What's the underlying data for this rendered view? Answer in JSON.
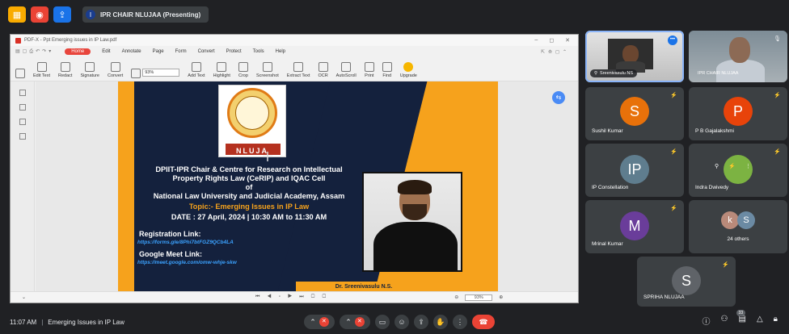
{
  "meeting": {
    "presenter_label": "IPR CHAIR NLUJAA (Presenting)",
    "presenter_initial": "I",
    "time": "11:07 AM",
    "separator": "|",
    "meeting_title": "Emerging Issues in IP Law",
    "participants_count": "33"
  },
  "pdf": {
    "window_title": "PDF-X - Ppt Emerging issues in IP Law.pdf",
    "menu": [
      "Home",
      "Edit",
      "Annotate",
      "Page",
      "Form",
      "Convert",
      "Protect",
      "Tools",
      "Help"
    ],
    "tools": [
      "Edit Text",
      "Redact",
      "Signature",
      "Convert",
      "Add Text",
      "Highlight",
      "Crop",
      "Screenshot",
      "Extract Text",
      "OCR",
      "AutoScroll",
      "Print",
      "Find",
      "Upgrade"
    ],
    "zoom": "93%",
    "status_zoom": "93%"
  },
  "poster": {
    "logo_text": "NLUJA",
    "line1": "DPIIT-IPR Chair & Centre for Research on Intellectual",
    "line2": "Property Rights Law (CeRIP) and IQAC Cell",
    "line3": "of",
    "line4": "National Law University and Judicial Academy, Assam",
    "topic": "Topic:- Emerging Issues in IP Law",
    "date": "DATE : 27 April, 2024  |  10:30 AM to 11:30 AM",
    "reg_label": "Registration Link:",
    "reg_link": "https://forms.gle/8Phi7btFGZ9QCb4LA",
    "meet_label": "Google Meet Link:",
    "meet_link": "https://meet.google.com/omw-whje-skw",
    "speaker": "Dr. Sreenivasulu N.S."
  },
  "tiles": [
    {
      "name": "Sreenivasulu NS",
      "kind": "video"
    },
    {
      "name": "IPR CHAIR NLUJAA",
      "kind": "video"
    },
    {
      "name": "Sushil Kumar",
      "initial": "S",
      "color": "#e8710a"
    },
    {
      "name": "P B Gajalakshmi",
      "initial": "P",
      "color": "#e8430a"
    },
    {
      "name": "IP Constellation",
      "initial": "IP",
      "color": "#5f7d8e"
    },
    {
      "name": "Indra Dwivedy",
      "kind": "speaking"
    },
    {
      "name": "Mrinal Kumar",
      "initial": "M",
      "color": "#6a3d9a"
    },
    {
      "name": "24 others",
      "initials": [
        "k",
        "S"
      ]
    },
    {
      "name": "SPRIHA NLUJAA",
      "initial": "S",
      "color": "#5f6368"
    }
  ],
  "colors": {
    "accent_red": "#ea4335",
    "navy": "#14213d",
    "orange": "#f6a21c"
  }
}
